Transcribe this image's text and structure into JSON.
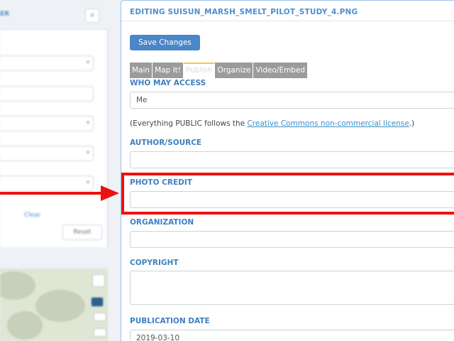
{
  "sidebar": {
    "header_label": "ER",
    "header_button": "×",
    "clear_label": "Clear",
    "reset_label": "Reset"
  },
  "editor": {
    "title": "EDITING SUISUN_MARSH_SMELT_PILOT_STUDY_4.PNG",
    "save_label": "Save Changes",
    "tabs": [
      {
        "label": "Main"
      },
      {
        "label": "Map It!"
      },
      {
        "label": "Publish"
      },
      {
        "label": "Organize"
      },
      {
        "label": "Video/Embed"
      }
    ],
    "who_may_access": {
      "label": "WHO MAY ACCESS",
      "value": "Me"
    },
    "license_note": {
      "prefix": "(Everything PUBLIC follows the ",
      "link": "Creative Commons non-commercial license",
      "suffix": ".)"
    },
    "author_source": {
      "label": "AUTHOR/SOURCE",
      "value": ""
    },
    "photo_credit": {
      "label": "PHOTO CREDIT",
      "value": ""
    },
    "organization": {
      "label": "ORGANIZATION",
      "value": ""
    },
    "copyright": {
      "label": "COPYRIGHT",
      "value": ""
    },
    "publication_date": {
      "label": "PUBLICATION DATE",
      "value": "2019-03-10"
    }
  },
  "colors": {
    "accent": "#4a86c8",
    "label_blue": "#3f7fc0",
    "annotation_red": "#ee1111",
    "tab_gray": "#9b9b9b"
  }
}
